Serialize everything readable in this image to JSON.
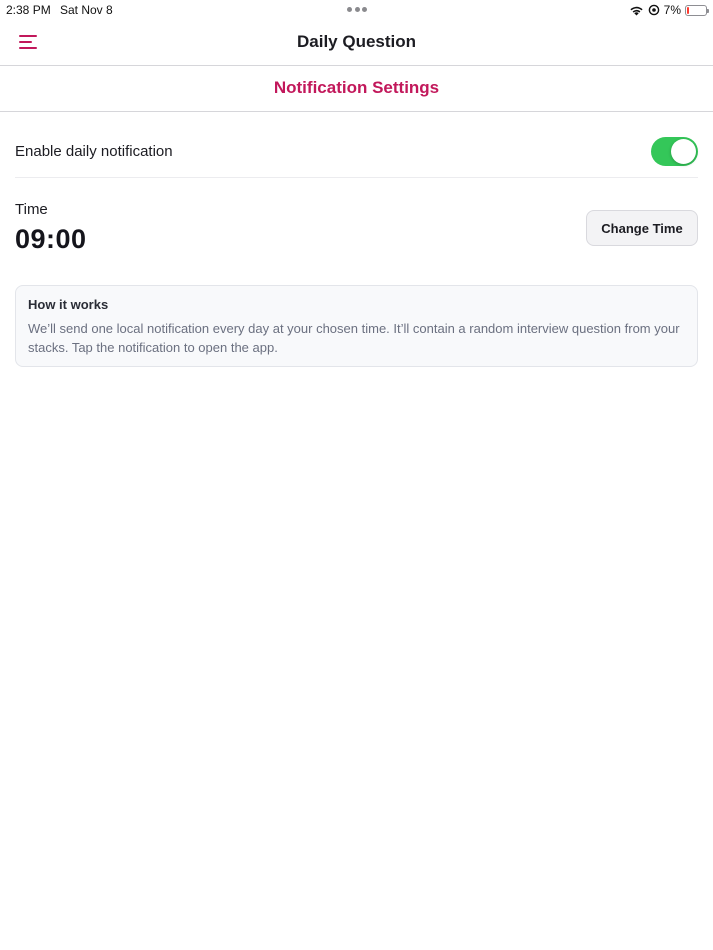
{
  "status_bar": {
    "time": "2:38 PM",
    "date": "Sat Nov 8",
    "battery_text": "7%",
    "battery_level": 0.07
  },
  "header": {
    "title": "Daily Question",
    "menu_icon": "hamburger-menu-icon"
  },
  "section": {
    "title": "Notification Settings"
  },
  "settings": {
    "enable_label": "Enable daily notification",
    "enabled": true,
    "time_label": "Time",
    "time_value": "09:00",
    "change_time_label": "Change Time"
  },
  "info": {
    "title": "How it works",
    "body": "We’ll send one local notification every day at your chosen time. It’ll contain a random interview question from your stacks. Tap the notification to open the app."
  },
  "colors": {
    "accent": "#c2185b",
    "toggle_on": "#34c759",
    "battery_low": "#ff3b30"
  }
}
